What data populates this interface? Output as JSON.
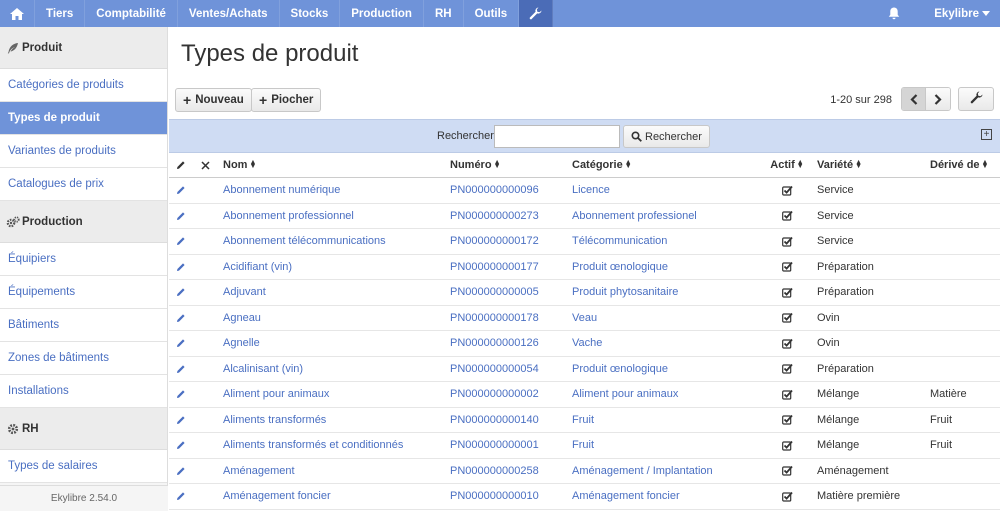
{
  "nav": {
    "items": [
      "Tiers",
      "Comptabilité",
      "Ventes/Achats",
      "Stocks",
      "Production",
      "RH",
      "Outils"
    ],
    "user": "Ekylibre",
    "accent": "#6f93d9"
  },
  "sidebar": {
    "sections": [
      {
        "title": "Produit",
        "icon": "feather-icon",
        "items": [
          "Catégories de produits",
          "Types de produit",
          "Variantes de produits",
          "Catalogues de prix"
        ]
      },
      {
        "title": "Production",
        "icon": "gears-icon",
        "items": [
          "Équipiers",
          "Équipements",
          "Bâtiments",
          "Zones de bâtiments",
          "Installations"
        ]
      },
      {
        "title": "RH",
        "icon": "gear-icon",
        "items": [
          "Types de salaires"
        ]
      }
    ],
    "active": "Types de produit",
    "footer": "Ekylibre 2.54.0"
  },
  "page": {
    "title": "Types de produit"
  },
  "toolbar": {
    "new_label": "Nouveau",
    "pick_label": "Piocher",
    "pagination": "1-20 sur 298"
  },
  "search": {
    "label": "Rechercher",
    "value": "",
    "placeholder": "",
    "button_label": "Rechercher"
  },
  "table": {
    "columns": {
      "name": "Nom",
      "number": "Numéro",
      "category": "Catégorie",
      "active": "Actif",
      "variety": "Variété",
      "derived": "Dérivé de"
    },
    "rows": [
      {
        "name": "Abonnement numérique",
        "number": "PN000000000096",
        "category": "Licence",
        "active": true,
        "variety": "Service",
        "derived": ""
      },
      {
        "name": "Abonnement professionnel",
        "number": "PN000000000273",
        "category": "Abonnement professionel",
        "active": true,
        "variety": "Service",
        "derived": ""
      },
      {
        "name": "Abonnement télécommunications",
        "number": "PN000000000172",
        "category": "Télécommunication",
        "active": true,
        "variety": "Service",
        "derived": ""
      },
      {
        "name": "Acidifiant (vin)",
        "number": "PN000000000177",
        "category": "Produit œnologique",
        "active": true,
        "variety": "Préparation",
        "derived": ""
      },
      {
        "name": "Adjuvant",
        "number": "PN000000000005",
        "category": "Produit phytosanitaire",
        "active": true,
        "variety": "Préparation",
        "derived": ""
      },
      {
        "name": "Agneau",
        "number": "PN000000000178",
        "category": "Veau",
        "active": true,
        "variety": "Ovin",
        "derived": ""
      },
      {
        "name": "Agnelle",
        "number": "PN000000000126",
        "category": "Vache",
        "active": true,
        "variety": "Ovin",
        "derived": ""
      },
      {
        "name": "Alcalinisant (vin)",
        "number": "PN000000000054",
        "category": "Produit œnologique",
        "active": true,
        "variety": "Préparation",
        "derived": ""
      },
      {
        "name": "Aliment pour animaux",
        "number": "PN000000000002",
        "category": "Aliment pour animaux",
        "active": true,
        "variety": "Mélange",
        "derived": "Matière"
      },
      {
        "name": "Aliments transformés",
        "number": "PN000000000140",
        "category": "Fruit",
        "active": true,
        "variety": "Mélange",
        "derived": "Fruit"
      },
      {
        "name": "Aliments transformés et conditionnés",
        "number": "PN000000000001",
        "category": "Fruit",
        "active": true,
        "variety": "Mélange",
        "derived": "Fruit"
      },
      {
        "name": "Aménagement",
        "number": "PN000000000258",
        "category": "Aménagement / Implantation",
        "active": true,
        "variety": "Aménagement",
        "derived": ""
      },
      {
        "name": "Aménagement foncier",
        "number": "PN000000000010",
        "category": "Aménagement foncier",
        "active": true,
        "variety": "Matière première",
        "derived": ""
      }
    ]
  }
}
